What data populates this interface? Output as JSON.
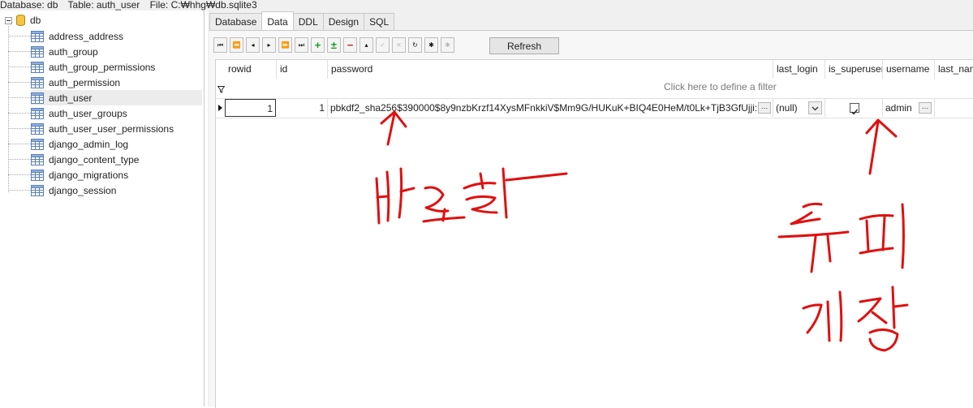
{
  "status_bar": {
    "database": "Database: db",
    "table": "Table: auth_user",
    "file": "File: C:₩hhg₩db.sqlite3"
  },
  "tree": {
    "root": "db",
    "tables": [
      "address_address",
      "auth_group",
      "auth_group_permissions",
      "auth_permission",
      "auth_user",
      "auth_user_groups",
      "auth_user_user_permissions",
      "django_admin_log",
      "django_content_type",
      "django_migrations",
      "django_session"
    ],
    "selected": "auth_user"
  },
  "tabs": [
    "Database",
    "Data",
    "DDL",
    "Design",
    "SQL"
  ],
  "active_tab": "Data",
  "toolbar": {
    "buttons": [
      "first-icon",
      "prev-page-icon",
      "prev-icon",
      "next-icon",
      "next-page-icon",
      "last-icon",
      "insert-icon",
      "insert-copy-icon",
      "delete-icon",
      "edit-up-icon",
      "post-check-icon",
      "cancel-x-icon",
      "refresh-arrow-icon",
      "asterisk-icon",
      "asterisk-disabled-icon"
    ],
    "refresh_label": "Refresh"
  },
  "grid": {
    "columns": [
      "rowid",
      "id",
      "password",
      "last_login",
      "is_superuser",
      "username",
      "last_nam"
    ],
    "filter_placeholder": "Click here to define a filter",
    "row": {
      "rowid": "1",
      "id": "1",
      "password": "pbkdf2_sha256$390000$8y9nzbKrzf14XysMFnkkiV$Mm9G/HUKuK+BIQ4E0HeM/t0Lk+TjB3GfUjji:",
      "last_login": "(null)",
      "is_superuser": true,
      "username": "admin"
    },
    "ellipsis": "…"
  },
  "annotations": {
    "color": "#e01010"
  }
}
